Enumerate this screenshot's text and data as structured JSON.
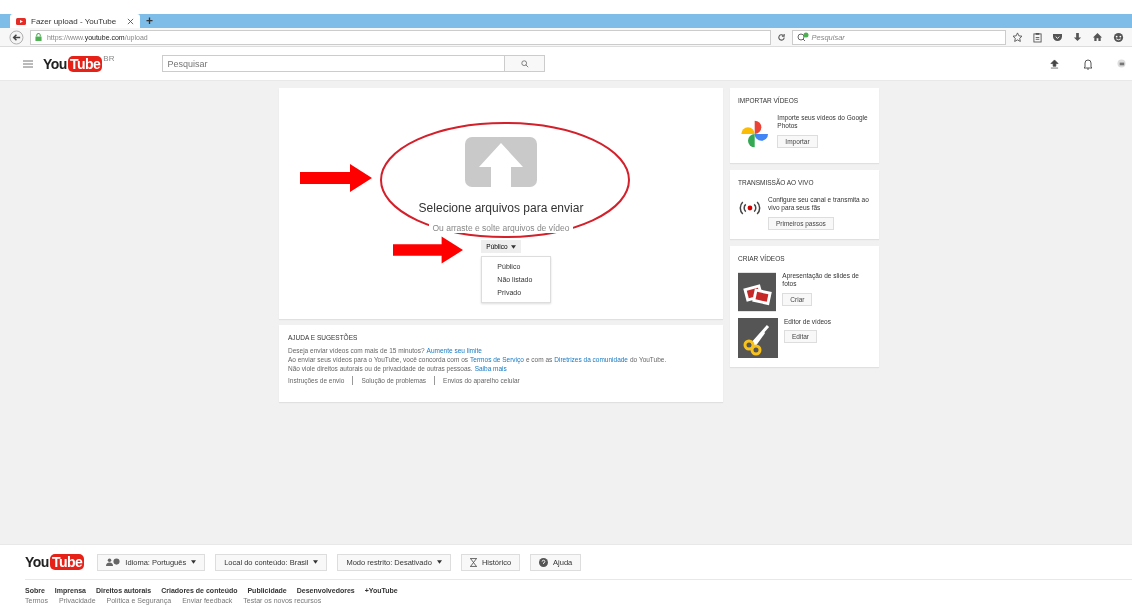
{
  "browser": {
    "tab_title": "Fazer upload - YouTube",
    "new_tab": "+",
    "url": "https://www.**youtube.com**/upload",
    "search_placeholder": "Pesquisar"
  },
  "header": {
    "logo_you": "You",
    "logo_tube": "Tube",
    "region": "BR",
    "search_placeholder": "Pesquisar"
  },
  "upload": {
    "title": "Selecione arquivos para enviar",
    "subtitle": "Ou arraste e solte arquivos de vídeo",
    "privacy_button": "Público",
    "privacy_menu": [
      "Público",
      "Não listado",
      "Privado"
    ]
  },
  "help": {
    "heading": "AJUDA E SUGESTÕES",
    "lines": [
      [
        {
          "kind": "text",
          "text": "Deseja enviar vídeos com mais de 15 minutos?"
        },
        {
          "kind": "link",
          "text": "Aumente seu limite"
        }
      ],
      [
        {
          "kind": "text",
          "text": "Ao enviar seus vídeos para o YouTube, você concorda com os"
        },
        {
          "kind": "link",
          "text": "Termos de Serviço"
        },
        {
          "kind": "text",
          "text": "e com as"
        },
        {
          "kind": "link",
          "text": "Diretrizes da comunidade"
        },
        {
          "kind": "text",
          "text": "do YouTube."
        }
      ],
      [
        {
          "kind": "text",
          "text": "Não viole direitos autorais ou de privacidade de outras pessoas."
        },
        {
          "kind": "link",
          "text": "Saiba mais"
        }
      ]
    ],
    "links": [
      "Instruções de envio",
      "Solução de problemas",
      "Envios do aparelho celular"
    ]
  },
  "side": [
    {
      "heading": "IMPORTAR VÍDEOS",
      "items": [
        {
          "kind": "photos",
          "text": "Importe seus vídeos do Google Photos",
          "button": "Importar"
        }
      ]
    },
    {
      "heading": "TRANSMISSÃO AO VIVO",
      "items": [
        {
          "kind": "live",
          "text": "Configure seu canal e transmita ao vivo para seus fãs",
          "button": "Primeiros passos"
        }
      ]
    },
    {
      "heading": "CRIAR VÍDEOS",
      "items": [
        {
          "kind": "slides",
          "text": "Apresentação de slides de fotos",
          "button": "Criar"
        },
        {
          "kind": "editor",
          "text": "Editor de vídeos",
          "button": "Editar"
        }
      ]
    }
  ],
  "footer": {
    "logo_you": "You",
    "logo_tube": "Tube",
    "buttons": [
      {
        "kind": "language",
        "label": "Idioma: Português",
        "caret": true
      },
      {
        "kind": "location",
        "label": "Local do conteúdo: Brasil",
        "caret": true
      },
      {
        "kind": "restricted",
        "label": "Modo restrito: Desativado",
        "caret": true
      },
      {
        "kind": "history",
        "label": "Histórico",
        "caret": false
      },
      {
        "kind": "help",
        "label": "Ajuda",
        "caret": false
      }
    ],
    "links": [
      "Sobre",
      "Imprensa",
      "Direitos autorais",
      "Criadores de conteúdo",
      "Publicidade",
      "Desenvolvedores",
      "+YouTube"
    ],
    "small_links": [
      "Termos",
      "Privacidade",
      "Política e Segurança",
      "Enviar feedback",
      "Testar os novos recursos"
    ]
  }
}
